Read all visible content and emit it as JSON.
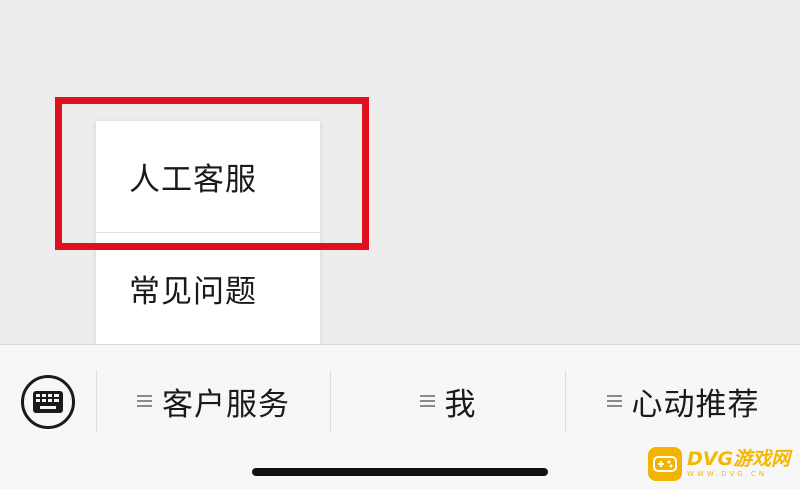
{
  "popup": {
    "items": [
      {
        "label": "人工客服"
      },
      {
        "label": "常见问题"
      }
    ]
  },
  "menubar": {
    "keyboard_icon": "keyboard-icon",
    "tabs": [
      {
        "label": "客户服务",
        "icon": "menu-lines-icon"
      },
      {
        "label": "我",
        "icon": "menu-lines-icon"
      },
      {
        "label": "心动推荐",
        "icon": "menu-lines-icon"
      }
    ]
  },
  "highlight": {
    "color": "#e01020"
  },
  "watermark": {
    "main": "DVG游戏网",
    "sub": "WWW.DVG.CN"
  }
}
